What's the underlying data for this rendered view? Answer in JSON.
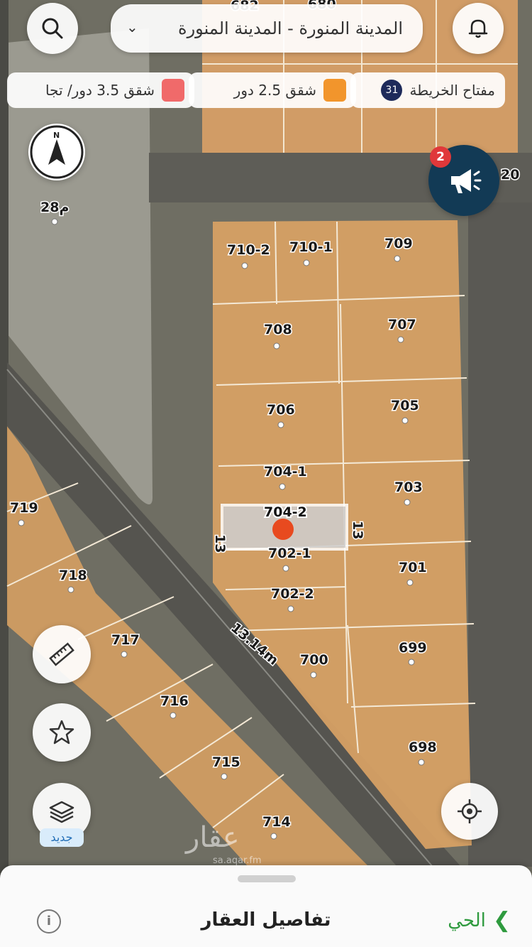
{
  "search_bar": {
    "location": "المدينة المنورة - المدينة المنورة"
  },
  "legend": [
    {
      "label": "شقق 3.5 دور/ تجا",
      "color": "#f06a6a"
    },
    {
      "label": "شقق 2.5 دور",
      "color": "#f2952c"
    },
    {
      "label": "مفتاح الخريطة",
      "badge": "31",
      "color": "#1e2a5a"
    }
  ],
  "announcement_badge": "2",
  "compass_label": "N",
  "road_measure": "13.14m",
  "selected_parcel": {
    "id": "704-2",
    "side_left": "13",
    "side_right": "13"
  },
  "parcels": [
    "710-2",
    "710-1",
    "709",
    "708",
    "707",
    "706",
    "705",
    "704-1",
    "704-2",
    "703",
    "702-1",
    "701",
    "702-2",
    "700",
    "699",
    "698",
    "719",
    "718",
    "717",
    "716",
    "715",
    "714",
    "28م"
  ],
  "edge_labels": [
    "682",
    "680",
    "20"
  ],
  "watermark": {
    "brand": "عقار",
    "url": "sa.aqar.fm"
  },
  "new_badge": "جديد",
  "bottom_sheet": {
    "title": "تفاصيل العقار",
    "link": "الحي"
  },
  "colors": {
    "parcel": "#d9a066",
    "accent_green": "#2e9a3e",
    "selected_marker": "#e84a1f"
  }
}
